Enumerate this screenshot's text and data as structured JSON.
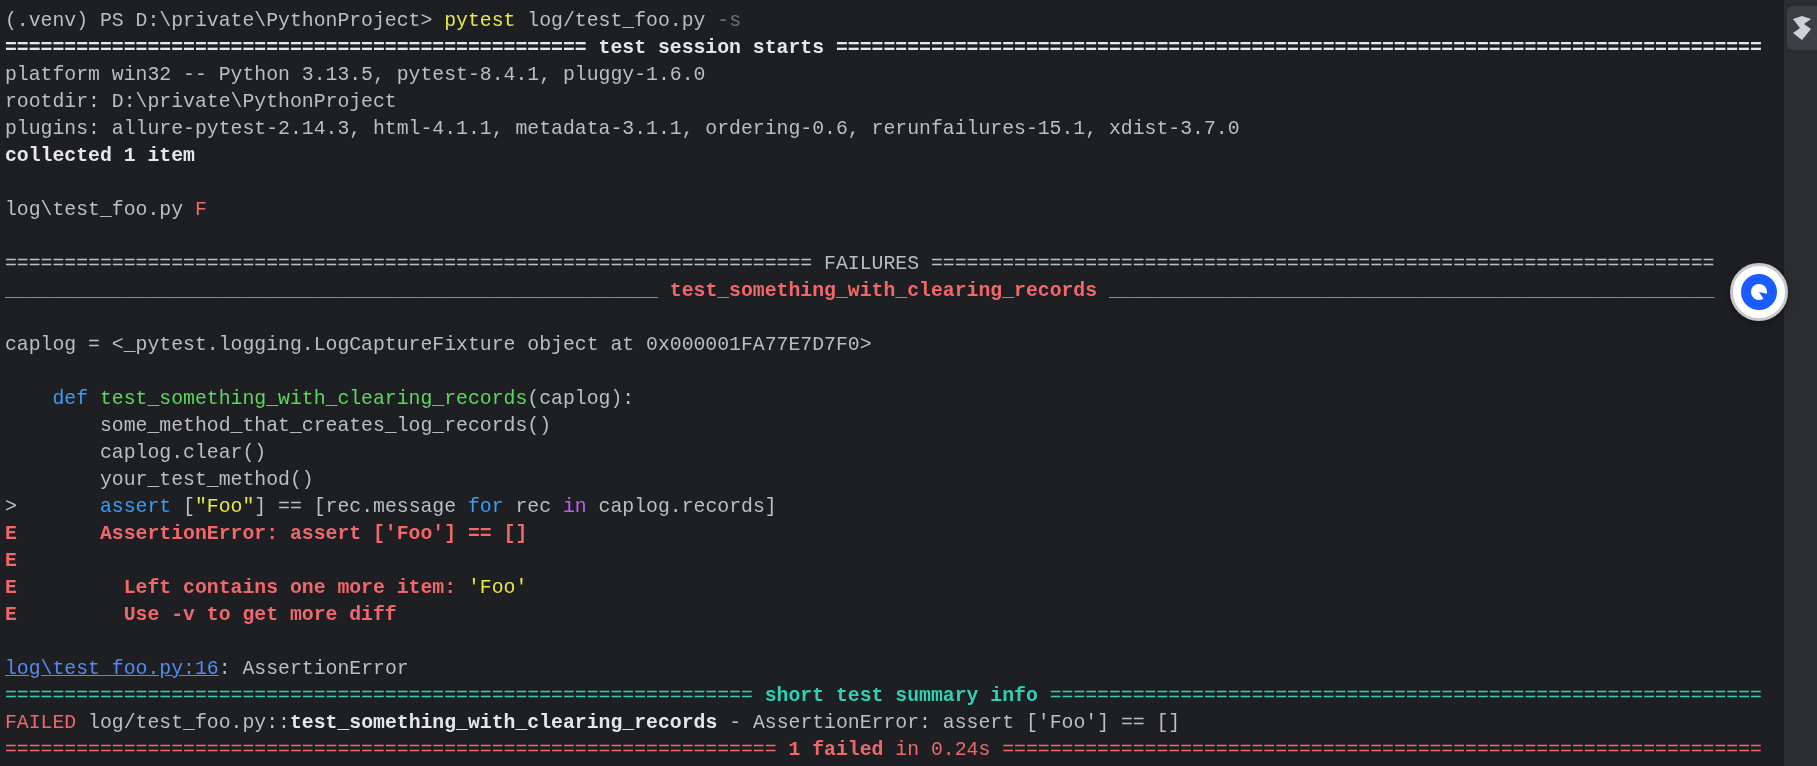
{
  "terminal": {
    "lines": [
      {
        "kind": "text",
        "segments": [
          {
            "text": "(.venv) PS D:\\private\\PythonProject> ",
            "kind": "plain"
          },
          {
            "text": "pytest",
            "kind": "yellow"
          },
          {
            "text": " log/test_foo.py ",
            "kind": "plain"
          },
          {
            "text": "-s",
            "kind": "dim"
          }
        ]
      },
      {
        "kind": "text",
        "segments": [
          {
            "text": "================================================= test session starts ==============================================================================",
            "kind": "bold"
          }
        ]
      },
      {
        "kind": "text",
        "segments": [
          {
            "text": "platform win32 -- Python 3.13.5, pytest-8.4.1, pluggy-1.6.0",
            "kind": "plain"
          }
        ]
      },
      {
        "kind": "text",
        "segments": [
          {
            "text": "rootdir: D:\\private\\PythonProject",
            "kind": "plain"
          }
        ]
      },
      {
        "kind": "text",
        "segments": [
          {
            "text": "plugins: allure-pytest-2.14.3, html-4.1.1, metadata-3.1.1, ordering-0.6, rerunfailures-15.1, xdist-3.7.0",
            "kind": "plain"
          }
        ]
      },
      {
        "kind": "text",
        "segments": [
          {
            "text": "collected 1 item",
            "kind": "bold"
          }
        ]
      },
      {
        "kind": "blank"
      },
      {
        "kind": "text",
        "segments": [
          {
            "text": "log\\test_foo.py ",
            "kind": "plain"
          },
          {
            "text": "F",
            "kind": "red"
          }
        ]
      },
      {
        "kind": "blank"
      },
      {
        "kind": "text",
        "segments": [
          {
            "text": "==================================================================== FAILURES ==================================================================",
            "kind": "plain"
          }
        ]
      },
      {
        "kind": "text",
        "segments": [
          {
            "text": "_______________________________________________________ ",
            "kind": "red"
          },
          {
            "text": "test_something_with_clearing_records",
            "kind": "red-bold"
          },
          {
            "text": " ___________________________________________________",
            "kind": "red"
          }
        ]
      },
      {
        "kind": "blank"
      },
      {
        "kind": "text",
        "segments": [
          {
            "text": "caplog = <_pytest.logging.LogCaptureFixture object at 0x000001FA77E7D7F0>",
            "kind": "plain"
          }
        ]
      },
      {
        "kind": "blank"
      },
      {
        "kind": "text",
        "segments": [
          {
            "text": "    def ",
            "kind": "blue"
          },
          {
            "text": "test_something_with_clearing_records",
            "kind": "green"
          },
          {
            "text": "(caplog):",
            "kind": "plain"
          }
        ]
      },
      {
        "kind": "text",
        "segments": [
          {
            "text": "        some_method_that_creates_log_records()",
            "kind": "plain"
          }
        ]
      },
      {
        "kind": "text",
        "segments": [
          {
            "text": "        caplog.clear()",
            "kind": "plain"
          }
        ]
      },
      {
        "kind": "text",
        "segments": [
          {
            "text": "        your_test_method()",
            "kind": "plain"
          }
        ]
      },
      {
        "kind": "text",
        "segments": [
          {
            "text": ">       ",
            "kind": "plain"
          },
          {
            "text": "assert",
            "kind": "blue"
          },
          {
            "text": " [",
            "kind": "plain"
          },
          {
            "text": "\"Foo\"",
            "kind": "yellow"
          },
          {
            "text": "] == [rec.message ",
            "kind": "plain"
          },
          {
            "text": "for",
            "kind": "blue"
          },
          {
            "text": " rec ",
            "kind": "plain"
          },
          {
            "text": "in",
            "kind": "magenta"
          },
          {
            "text": " caplog.records]",
            "kind": "plain"
          }
        ]
      },
      {
        "kind": "text",
        "segments": [
          {
            "text": "E       AssertionError: assert ['Foo'] == []",
            "kind": "red-bold"
          }
        ]
      },
      {
        "kind": "text",
        "segments": [
          {
            "text": "E",
            "kind": "red-bold"
          }
        ]
      },
      {
        "kind": "text",
        "segments": [
          {
            "text": "E         Left contains one more item: ",
            "kind": "red-bold"
          },
          {
            "text": "'Foo'",
            "kind": "yellow"
          }
        ]
      },
      {
        "kind": "text",
        "segments": [
          {
            "text": "E         Use -v to get more diff",
            "kind": "red-bold"
          }
        ]
      },
      {
        "kind": "blank"
      },
      {
        "kind": "text",
        "segments": [
          {
            "text": "log\\test_foo.py:16",
            "kind": "link"
          },
          {
            "text": ": AssertionError",
            "kind": "plain"
          }
        ]
      },
      {
        "kind": "text",
        "segments": [
          {
            "text": "=============================================================== ",
            "kind": "cyan"
          },
          {
            "text": "short test summary info",
            "kind": "cyan-bold"
          },
          {
            "text": " ============================================================",
            "kind": "cyan"
          }
        ]
      },
      {
        "kind": "text",
        "segments": [
          {
            "text": "FAILED",
            "kind": "red"
          },
          {
            "text": " log/test_foo.py::",
            "kind": "plain"
          },
          {
            "text": "test_something_with_clearing_records",
            "kind": "bold"
          },
          {
            "text": " - AssertionError: assert ['Foo'] == []",
            "kind": "plain"
          }
        ]
      },
      {
        "kind": "text",
        "segments": [
          {
            "text": "================================================================= ",
            "kind": "red"
          },
          {
            "text": "1 failed",
            "kind": "red-bold"
          },
          {
            "text": " in 0.24s ",
            "kind": "red"
          },
          {
            "text": "================================================================",
            "kind": "red"
          }
        ]
      }
    ]
  }
}
